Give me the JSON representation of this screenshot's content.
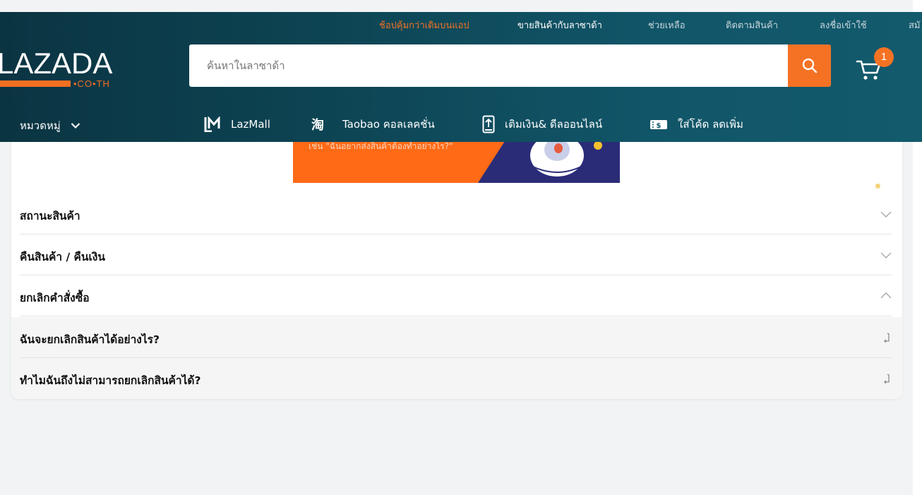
{
  "topbar": {
    "links": [
      {
        "label": "ช้อปคุ้มกว่าเดิมบนแอป",
        "color": "#f57224"
      },
      {
        "label": "ขายสินค้ากับลาซาด้า",
        "color": "#ffffff"
      },
      {
        "label": "ช่วยเหลือ",
        "color": "#c8d6db"
      },
      {
        "label": "ติดตามสินค้า",
        "color": "#c8d6db"
      },
      {
        "label": "ลงชื่อเข้าใช้",
        "color": "#c8d6db"
      },
      {
        "label": "สมั",
        "color": "#c8d6db"
      }
    ]
  },
  "logo": {
    "text": "LAZADA",
    "suffix": "•CO•TH",
    "brand_color": "#f36f21"
  },
  "search": {
    "placeholder": "ค้นหาในลาซาด้า",
    "value": "",
    "icon": "search-icon",
    "button_color": "#f57224"
  },
  "cart": {
    "icon": "cart-icon",
    "count": "1"
  },
  "nav": {
    "categories_label": "หมวดหมู่",
    "items": [
      {
        "label": "LazMall",
        "icon": "lazmall-icon"
      },
      {
        "label": "Taobao คอลเลคชั่น",
        "icon": "taobao-icon"
      },
      {
        "label": "เติมเงิน& ดีลออนไลน์",
        "icon": "phone-topup-icon"
      },
      {
        "label": "ใส่โค้ด ลดเพิ่ม",
        "icon": "voucher-icon"
      }
    ]
  },
  "banner": {
    "text": "เช่น \"ฉันอยากส่งสินค้าต้องทำอย่างไร?\""
  },
  "faq": {
    "sections": [
      {
        "title": "สถานะสินค้า",
        "expanded": false
      },
      {
        "title": "คืนสินค้า / คืนเงิน",
        "expanded": false
      },
      {
        "title": "ยกเลิกคำสั่งซื้อ",
        "expanded": true
      }
    ],
    "questions": [
      {
        "text": "ฉันจะยกเลิกสินค้าได้อย่างไร?"
      },
      {
        "text": "ทำไมฉันถึงไม่สามารถยกเลิกสินค้าได้?"
      }
    ]
  }
}
